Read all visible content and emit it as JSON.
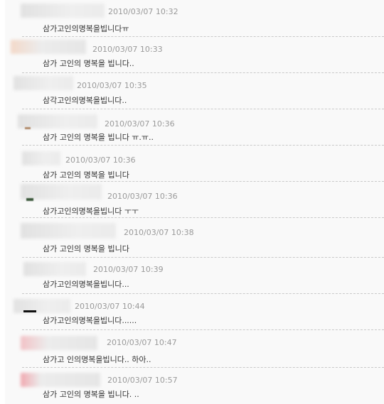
{
  "comments": [
    {
      "time": "2010/03/07 10:32",
      "text": "삼가고인의명복을빕니다ㅠ"
    },
    {
      "time": "2010/03/07 10:33",
      "text": "삼가 고인의 명복을 빕니다.."
    },
    {
      "time": "2010/03/07 10:35",
      "text": "삼각고인의명복을빕니다.."
    },
    {
      "time": "2010/03/07 10:36",
      "text": "삼가 고인의 명복을 빕니다 ㅠ.ㅠ.."
    },
    {
      "time": "2010/03/07 10:36",
      "text": "삼가 고인의 명복을 빕니다"
    },
    {
      "time": "2010/03/07 10:36",
      "text": "삼가고인의명복을빕니다 ㅜㅜ"
    },
    {
      "time": "2010/03/07 10:38",
      "text": "삼가 고인의 명복을 빕니다"
    },
    {
      "time": "2010/03/07 10:39",
      "text": "삼가고인의명복을빕니다..."
    },
    {
      "time": "2010/03/07 10:44",
      "text": "삼가고인의명복을빕니다......"
    },
    {
      "time": "2010/03/07 10:47",
      "text": "삼가고 인의명복을빕니다.. 하아.."
    },
    {
      "time": "2010/03/07 10:57",
      "text": "삼가 고인의 명복을 빕니다. .."
    }
  ]
}
